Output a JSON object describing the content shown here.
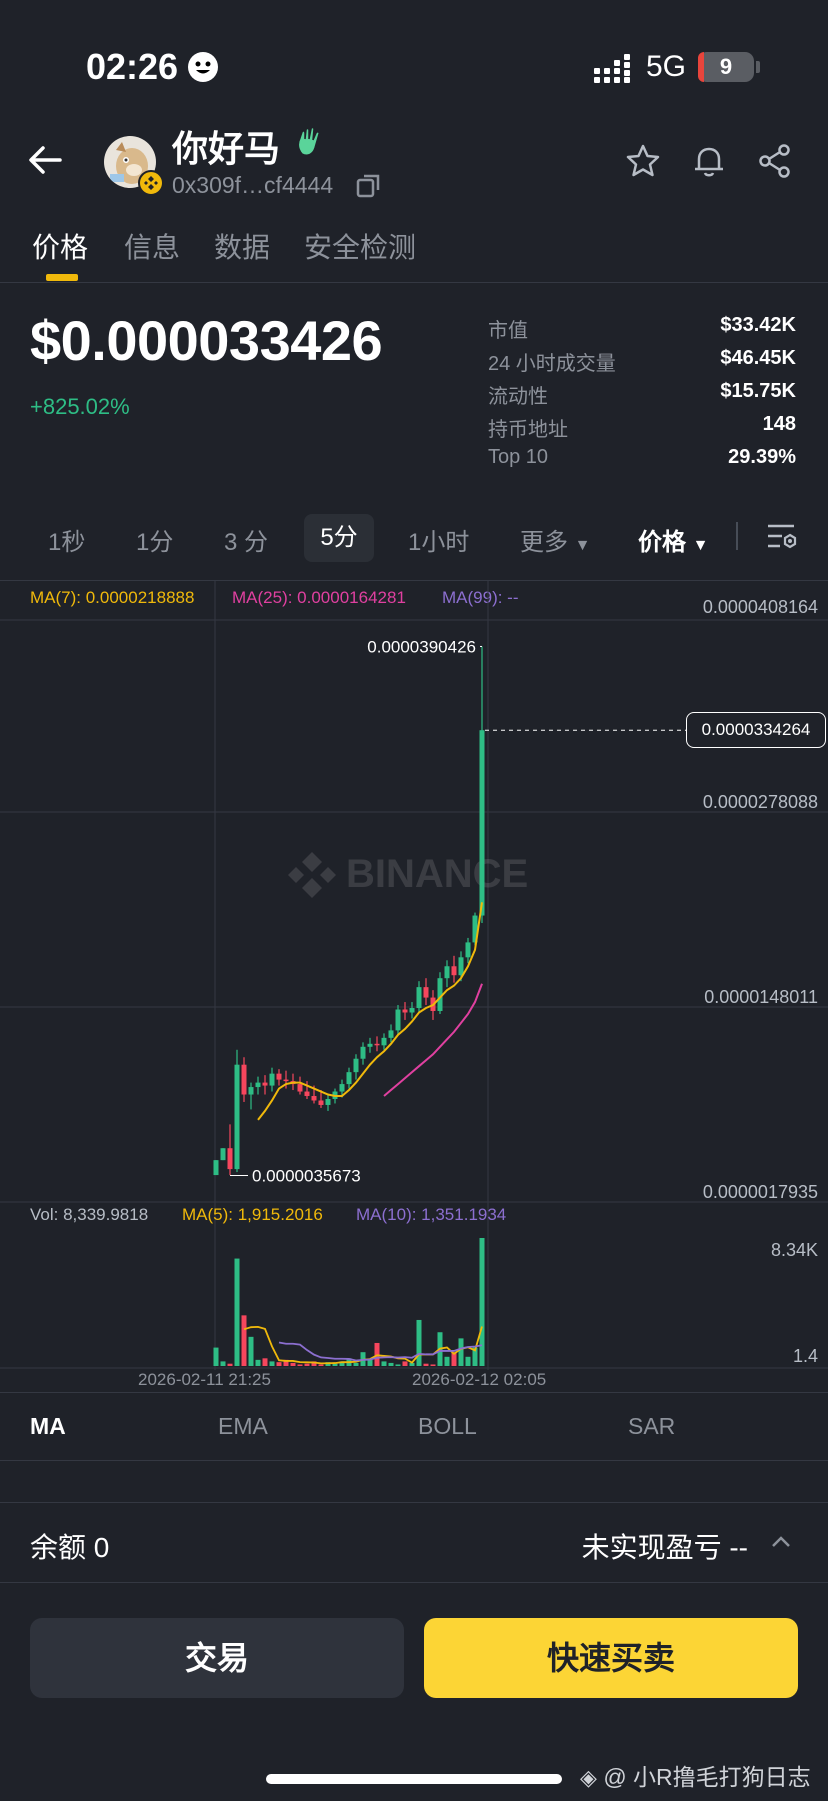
{
  "status_bar": {
    "time": "02:26",
    "network": "5G",
    "battery": "9"
  },
  "header": {
    "token_name": "你好马",
    "address": "0x309f…cf4444",
    "icons": [
      "back-arrow-icon",
      "star-icon",
      "bell-icon",
      "share-icon",
      "copy-icon"
    ]
  },
  "tabs": [
    "价格",
    "信息",
    "数据",
    "安全检测"
  ],
  "price": {
    "value": "$0.000033426",
    "change": "+825.02%"
  },
  "stats": [
    {
      "label": "市值",
      "value": "$33.42K"
    },
    {
      "label": "24 小时成交量",
      "value": "$46.45K"
    },
    {
      "label": "流动性",
      "value": "$15.75K"
    },
    {
      "label": "持币地址",
      "value": "148"
    },
    {
      "label": "Top 10",
      "value": "29.39%"
    }
  ],
  "intervals": [
    "1秒",
    "1分",
    "3 分",
    "5分",
    "1小时",
    "更多"
  ],
  "selected_interval": "5分",
  "price_toggle": "价格",
  "chart": {
    "ma7": "MA(7): 0.0000218888",
    "ma25": "MA(25): 0.0000164281",
    "ma99": "MA(99): --",
    "axis_labels": [
      "0.0000408164",
      "0.0000278088",
      "0.0000148011",
      "0.0000017935"
    ],
    "high_label": "0.0000390426",
    "low_label": "0.0000035673",
    "last_price": "0.0000334264",
    "watermark": "BINANCE",
    "vol": "Vol: 8,339.9818",
    "vol_ma5": "MA(5): 1,915.2016",
    "vol_ma10": "MA(10): 1,351.1934",
    "vol_axis_top": "8.34K",
    "vol_axis_bottom": "1.4",
    "time_labels": [
      "2026-02-11 21:25",
      "2026-02-12 02:05"
    ],
    "colors": {
      "up": "#2ebd85",
      "down": "#f6465d",
      "ma7": "#f0b90b",
      "ma25": "#e040a0",
      "ma99": "#8c6fd0"
    }
  },
  "chart_data": {
    "type": "candlestick",
    "y_range": [
      1.7935e-06,
      4.08164e-05
    ],
    "high": 3.90426e-05,
    "low": 3.5673e-06,
    "last": 3.34264e-05,
    "candles": [
      [
        3.6e-06,
        4.6e-06,
        3.6e-06,
        4.6e-06
      ],
      [
        4.6e-06,
        5.4e-06,
        4.6e-06,
        5.4e-06
      ],
      [
        5.4e-06,
        7e-06,
        3.6e-06,
        4e-06
      ],
      [
        4e-06,
        1.2e-05,
        3.8e-06,
        1.1e-05
      ],
      [
        1.1e-05,
        1.15e-05,
        8.5e-06,
        9e-06
      ],
      [
        9e-06,
        9.8e-06,
        8e-06,
        9.5e-06
      ],
      [
        9.5e-06,
        1.02e-05,
        9e-06,
        9.8e-06
      ],
      [
        9.8e-06,
        1.03e-05,
        9e-06,
        9.6e-06
      ],
      [
        9.6e-06,
        1.08e-05,
        9.2e-06,
        1.04e-05
      ],
      [
        1.04e-05,
        1.07e-05,
        9.6e-06,
        1e-05
      ],
      [
        1e-05,
        1.06e-05,
        9.4e-06,
        9.9e-06
      ],
      [
        9.9e-06,
        1.04e-05,
        9.3e-06,
        9.7e-06
      ],
      [
        9.7e-06,
        1.02e-05,
        9e-06,
        9.2e-06
      ],
      [
        9.2e-06,
        9.9e-06,
        8.7e-06,
        8.9e-06
      ],
      [
        8.9e-06,
        9.6e-06,
        8.4e-06,
        8.6e-06
      ],
      [
        8.6e-06,
        9.3e-06,
        8.1e-06,
        8.3e-06
      ],
      [
        8.3e-06,
        9e-06,
        7.9e-06,
        8.7e-06
      ],
      [
        8.7e-06,
        9.4e-06,
        8.4e-06,
        9.2e-06
      ],
      [
        9.2e-06,
        1e-05,
        8.8e-06,
        9.7e-06
      ],
      [
        9.7e-06,
        1.08e-05,
        9.4e-06,
        1.05e-05
      ],
      [
        1.05e-05,
        1.17e-05,
        1e-05,
        1.14e-05
      ],
      [
        1.14e-05,
        1.25e-05,
        1.1e-05,
        1.22e-05
      ],
      [
        1.22e-05,
        1.28e-05,
        1.18e-05,
        1.24e-05
      ],
      [
        1.24e-05,
        1.29e-05,
        1.19e-05,
        1.23e-05
      ],
      [
        1.23e-05,
        1.31e-05,
        1.2e-05,
        1.28e-05
      ],
      [
        1.28e-05,
        1.37e-05,
        1.25e-05,
        1.33e-05
      ],
      [
        1.33e-05,
        1.5e-05,
        1.3e-05,
        1.47e-05
      ],
      [
        1.47e-05,
        1.52e-05,
        1.4e-05,
        1.45e-05
      ],
      [
        1.45e-05,
        1.52e-05,
        1.41e-05,
        1.48e-05
      ],
      [
        1.48e-05,
        1.66e-05,
        1.45e-05,
        1.62e-05
      ],
      [
        1.62e-05,
        1.68e-05,
        1.5e-05,
        1.55e-05
      ],
      [
        1.55e-05,
        1.6e-05,
        1.4e-05,
        1.46e-05
      ],
      [
        1.46e-05,
        1.72e-05,
        1.44e-05,
        1.68e-05
      ],
      [
        1.68e-05,
        1.8e-05,
        1.62e-05,
        1.76e-05
      ],
      [
        1.76e-05,
        1.83e-05,
        1.65e-05,
        1.7e-05
      ],
      [
        1.7e-05,
        1.86e-05,
        1.66e-05,
        1.82e-05
      ],
      [
        1.82e-05,
        1.95e-05,
        1.78e-05,
        1.92e-05
      ],
      [
        1.92e-05,
        2.12e-05,
        1.9e-05,
        2.1e-05
      ],
      [
        2.1e-05,
        3.90426e-05,
        2.05e-05,
        3.34264e-05
      ]
    ],
    "ma7": [
      null,
      null,
      null,
      null,
      null,
      null,
      7.3e-06,
      7.9e-06,
      8.6e-06,
      9.4e-06,
      9.7e-06,
      9.8e-06,
      9.8e-06,
      9.6e-06,
      9.4e-06,
      9.2e-06,
      9e-06,
      8.9e-06,
      8.9e-06,
      9.3e-06,
      9.8e-06,
      1.04e-05,
      1.1e-05,
      1.15e-05,
      1.19e-05,
      1.24e-05,
      1.3e-05,
      1.34e-05,
      1.39e-05,
      1.45e-05,
      1.48e-05,
      1.5e-05,
      1.55e-05,
      1.6e-05,
      1.63e-05,
      1.68e-05,
      1.76e-05,
      1.87e-05,
      2.18888e-05
    ],
    "ma25": [
      null,
      null,
      null,
      null,
      null,
      null,
      null,
      null,
      null,
      null,
      null,
      null,
      null,
      null,
      null,
      null,
      null,
      null,
      null,
      null,
      null,
      null,
      null,
      null,
      8.9e-06,
      9.3e-06,
      9.7e-06,
      1.01e-05,
      1.05e-05,
      1.09e-05,
      1.13e-05,
      1.17e-05,
      1.22e-05,
      1.27e-05,
      1.32e-05,
      1.38e-05,
      1.44e-05,
      1.52e-05,
      1.64281e-05
    ],
    "volume": {
      "y_max": 8339.9818,
      "values": [
        1200,
        300,
        150,
        7000,
        3300,
        1900,
        400,
        500,
        300,
        250,
        400,
        200,
        100,
        150,
        300,
        100,
        250,
        150,
        300,
        500,
        200,
        900,
        400,
        1500,
        300,
        200,
        100,
        300,
        200,
        3000,
        150,
        100,
        2200,
        600,
        900,
        1800,
        600,
        1200,
        8339.9818
      ],
      "up": [
        true,
        true,
        false,
        true,
        false,
        true,
        true,
        false,
        true,
        false,
        false,
        false,
        false,
        false,
        false,
        false,
        true,
        true,
        true,
        true,
        true,
        true,
        true,
        false,
        true,
        true,
        true,
        false,
        true,
        true,
        false,
        false,
        true,
        true,
        false,
        true,
        true,
        true,
        true
      ],
      "ma5": [
        null,
        null,
        null,
        null,
        2390,
        2530,
        2550,
        2420,
        1280,
        370,
        330,
        330,
        250,
        240,
        230,
        170,
        180,
        190,
        250,
        250,
        280,
        410,
        450,
        700,
        660,
        620,
        500,
        480,
        220,
        760,
        750,
        750,
        1130,
        1210,
        790,
        1120,
        1220,
        1020,
        2570
      ],
      "ma10": [
        null,
        null,
        null,
        null,
        null,
        null,
        null,
        null,
        null,
        1530,
        1450,
        1450,
        1390,
        1040,
        740,
        560,
        520,
        470,
        470,
        460,
        360,
        400,
        420,
        540,
        560,
        580,
        550,
        580,
        540,
        790,
        760,
        760,
        990,
        980,
        980,
        1140,
        1240,
        1270,
        1351.1934
      ]
    }
  },
  "indicators": [
    "MA",
    "EMA",
    "BOLL",
    "SAR"
  ],
  "balance": "余额 0",
  "pnl": "未实现盈亏 --",
  "buttons": {
    "trade": "交易",
    "quick": "快速买卖"
  },
  "watermark_text": "@ 小R撸毛打狗日志"
}
